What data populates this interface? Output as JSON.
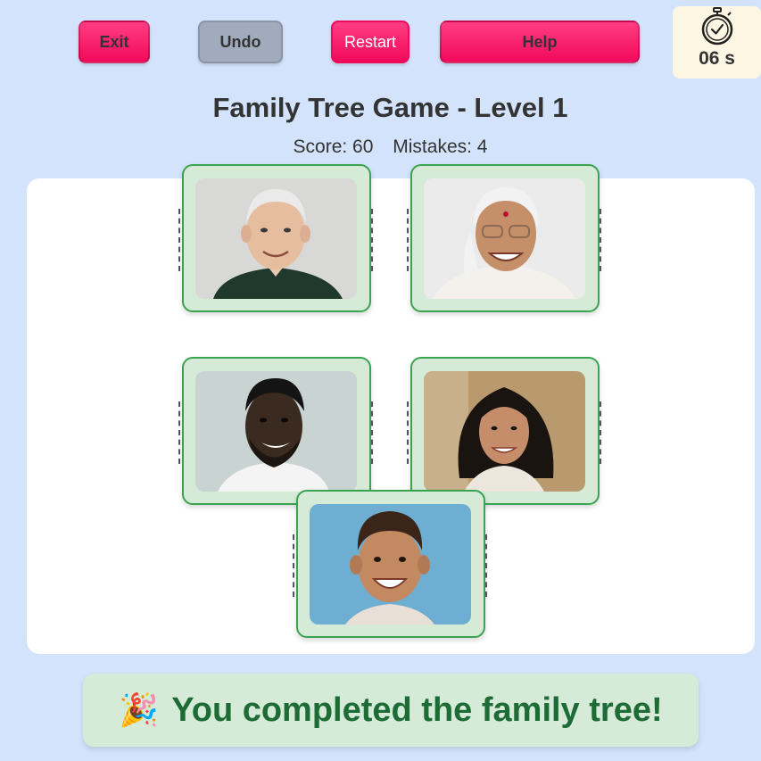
{
  "toolbar": {
    "exit_label": "Exit",
    "undo_label": "Undo",
    "restart_label": "Restart",
    "help_label": "Help"
  },
  "timer": {
    "icon": "stopwatch-icon",
    "text": "06 s"
  },
  "game": {
    "title": "Family Tree Game - Level 1",
    "score_label": "Score: 60",
    "mistakes_label": "Mistakes: 4"
  },
  "cards": [
    {
      "id": "grandpa",
      "icon": "elderly-man-portrait"
    },
    {
      "id": "grandma",
      "icon": "elderly-woman-portrait"
    },
    {
      "id": "father",
      "icon": "man-portrait"
    },
    {
      "id": "mother",
      "icon": "woman-portrait"
    },
    {
      "id": "child",
      "icon": "child-portrait"
    }
  ],
  "completion": {
    "icon": "party-popper-icon",
    "glyph": "🎉",
    "message": "You completed the family tree!"
  },
  "colors": {
    "background": "#d3e3fb",
    "accent_pink": "#f2095b",
    "card_border": "#3aa350",
    "card_fill": "#d5ebd8",
    "success_text": "#1d6b35"
  }
}
